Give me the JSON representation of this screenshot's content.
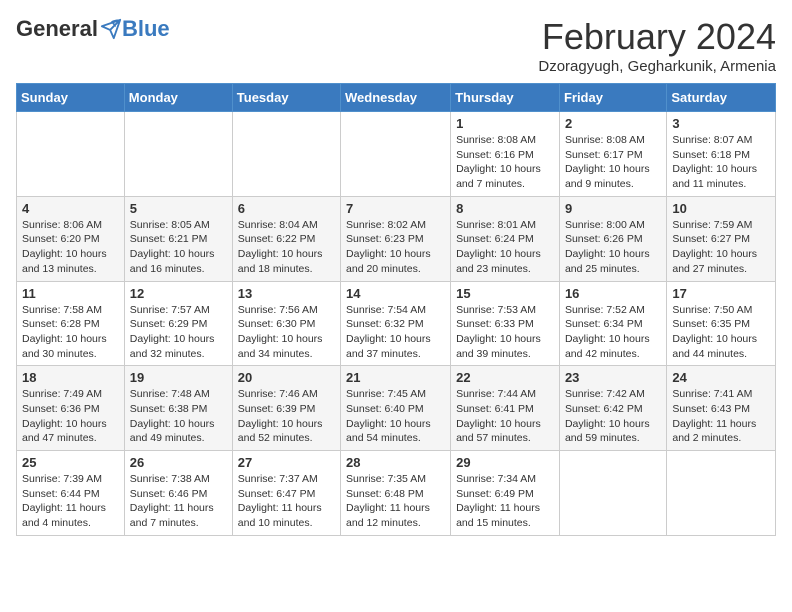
{
  "header": {
    "logo_general": "General",
    "logo_blue": "Blue",
    "month_title": "February 2024",
    "location": "Dzoragyugh, Gegharkunik, Armenia"
  },
  "days_of_week": [
    "Sunday",
    "Monday",
    "Tuesday",
    "Wednesday",
    "Thursday",
    "Friday",
    "Saturday"
  ],
  "weeks": [
    [
      {
        "day": "",
        "info": ""
      },
      {
        "day": "",
        "info": ""
      },
      {
        "day": "",
        "info": ""
      },
      {
        "day": "",
        "info": ""
      },
      {
        "day": "1",
        "info": "Sunrise: 8:08 AM\nSunset: 6:16 PM\nDaylight: 10 hours and 7 minutes."
      },
      {
        "day": "2",
        "info": "Sunrise: 8:08 AM\nSunset: 6:17 PM\nDaylight: 10 hours and 9 minutes."
      },
      {
        "day": "3",
        "info": "Sunrise: 8:07 AM\nSunset: 6:18 PM\nDaylight: 10 hours and 11 minutes."
      }
    ],
    [
      {
        "day": "4",
        "info": "Sunrise: 8:06 AM\nSunset: 6:20 PM\nDaylight: 10 hours and 13 minutes."
      },
      {
        "day": "5",
        "info": "Sunrise: 8:05 AM\nSunset: 6:21 PM\nDaylight: 10 hours and 16 minutes."
      },
      {
        "day": "6",
        "info": "Sunrise: 8:04 AM\nSunset: 6:22 PM\nDaylight: 10 hours and 18 minutes."
      },
      {
        "day": "7",
        "info": "Sunrise: 8:02 AM\nSunset: 6:23 PM\nDaylight: 10 hours and 20 minutes."
      },
      {
        "day": "8",
        "info": "Sunrise: 8:01 AM\nSunset: 6:24 PM\nDaylight: 10 hours and 23 minutes."
      },
      {
        "day": "9",
        "info": "Sunrise: 8:00 AM\nSunset: 6:26 PM\nDaylight: 10 hours and 25 minutes."
      },
      {
        "day": "10",
        "info": "Sunrise: 7:59 AM\nSunset: 6:27 PM\nDaylight: 10 hours and 27 minutes."
      }
    ],
    [
      {
        "day": "11",
        "info": "Sunrise: 7:58 AM\nSunset: 6:28 PM\nDaylight: 10 hours and 30 minutes."
      },
      {
        "day": "12",
        "info": "Sunrise: 7:57 AM\nSunset: 6:29 PM\nDaylight: 10 hours and 32 minutes."
      },
      {
        "day": "13",
        "info": "Sunrise: 7:56 AM\nSunset: 6:30 PM\nDaylight: 10 hours and 34 minutes."
      },
      {
        "day": "14",
        "info": "Sunrise: 7:54 AM\nSunset: 6:32 PM\nDaylight: 10 hours and 37 minutes."
      },
      {
        "day": "15",
        "info": "Sunrise: 7:53 AM\nSunset: 6:33 PM\nDaylight: 10 hours and 39 minutes."
      },
      {
        "day": "16",
        "info": "Sunrise: 7:52 AM\nSunset: 6:34 PM\nDaylight: 10 hours and 42 minutes."
      },
      {
        "day": "17",
        "info": "Sunrise: 7:50 AM\nSunset: 6:35 PM\nDaylight: 10 hours and 44 minutes."
      }
    ],
    [
      {
        "day": "18",
        "info": "Sunrise: 7:49 AM\nSunset: 6:36 PM\nDaylight: 10 hours and 47 minutes."
      },
      {
        "day": "19",
        "info": "Sunrise: 7:48 AM\nSunset: 6:38 PM\nDaylight: 10 hours and 49 minutes."
      },
      {
        "day": "20",
        "info": "Sunrise: 7:46 AM\nSunset: 6:39 PM\nDaylight: 10 hours and 52 minutes."
      },
      {
        "day": "21",
        "info": "Sunrise: 7:45 AM\nSunset: 6:40 PM\nDaylight: 10 hours and 54 minutes."
      },
      {
        "day": "22",
        "info": "Sunrise: 7:44 AM\nSunset: 6:41 PM\nDaylight: 10 hours and 57 minutes."
      },
      {
        "day": "23",
        "info": "Sunrise: 7:42 AM\nSunset: 6:42 PM\nDaylight: 10 hours and 59 minutes."
      },
      {
        "day": "24",
        "info": "Sunrise: 7:41 AM\nSunset: 6:43 PM\nDaylight: 11 hours and 2 minutes."
      }
    ],
    [
      {
        "day": "25",
        "info": "Sunrise: 7:39 AM\nSunset: 6:44 PM\nDaylight: 11 hours and 4 minutes."
      },
      {
        "day": "26",
        "info": "Sunrise: 7:38 AM\nSunset: 6:46 PM\nDaylight: 11 hours and 7 minutes."
      },
      {
        "day": "27",
        "info": "Sunrise: 7:37 AM\nSunset: 6:47 PM\nDaylight: 11 hours and 10 minutes."
      },
      {
        "day": "28",
        "info": "Sunrise: 7:35 AM\nSunset: 6:48 PM\nDaylight: 11 hours and 12 minutes."
      },
      {
        "day": "29",
        "info": "Sunrise: 7:34 AM\nSunset: 6:49 PM\nDaylight: 11 hours and 15 minutes."
      },
      {
        "day": "",
        "info": ""
      },
      {
        "day": "",
        "info": ""
      }
    ]
  ]
}
